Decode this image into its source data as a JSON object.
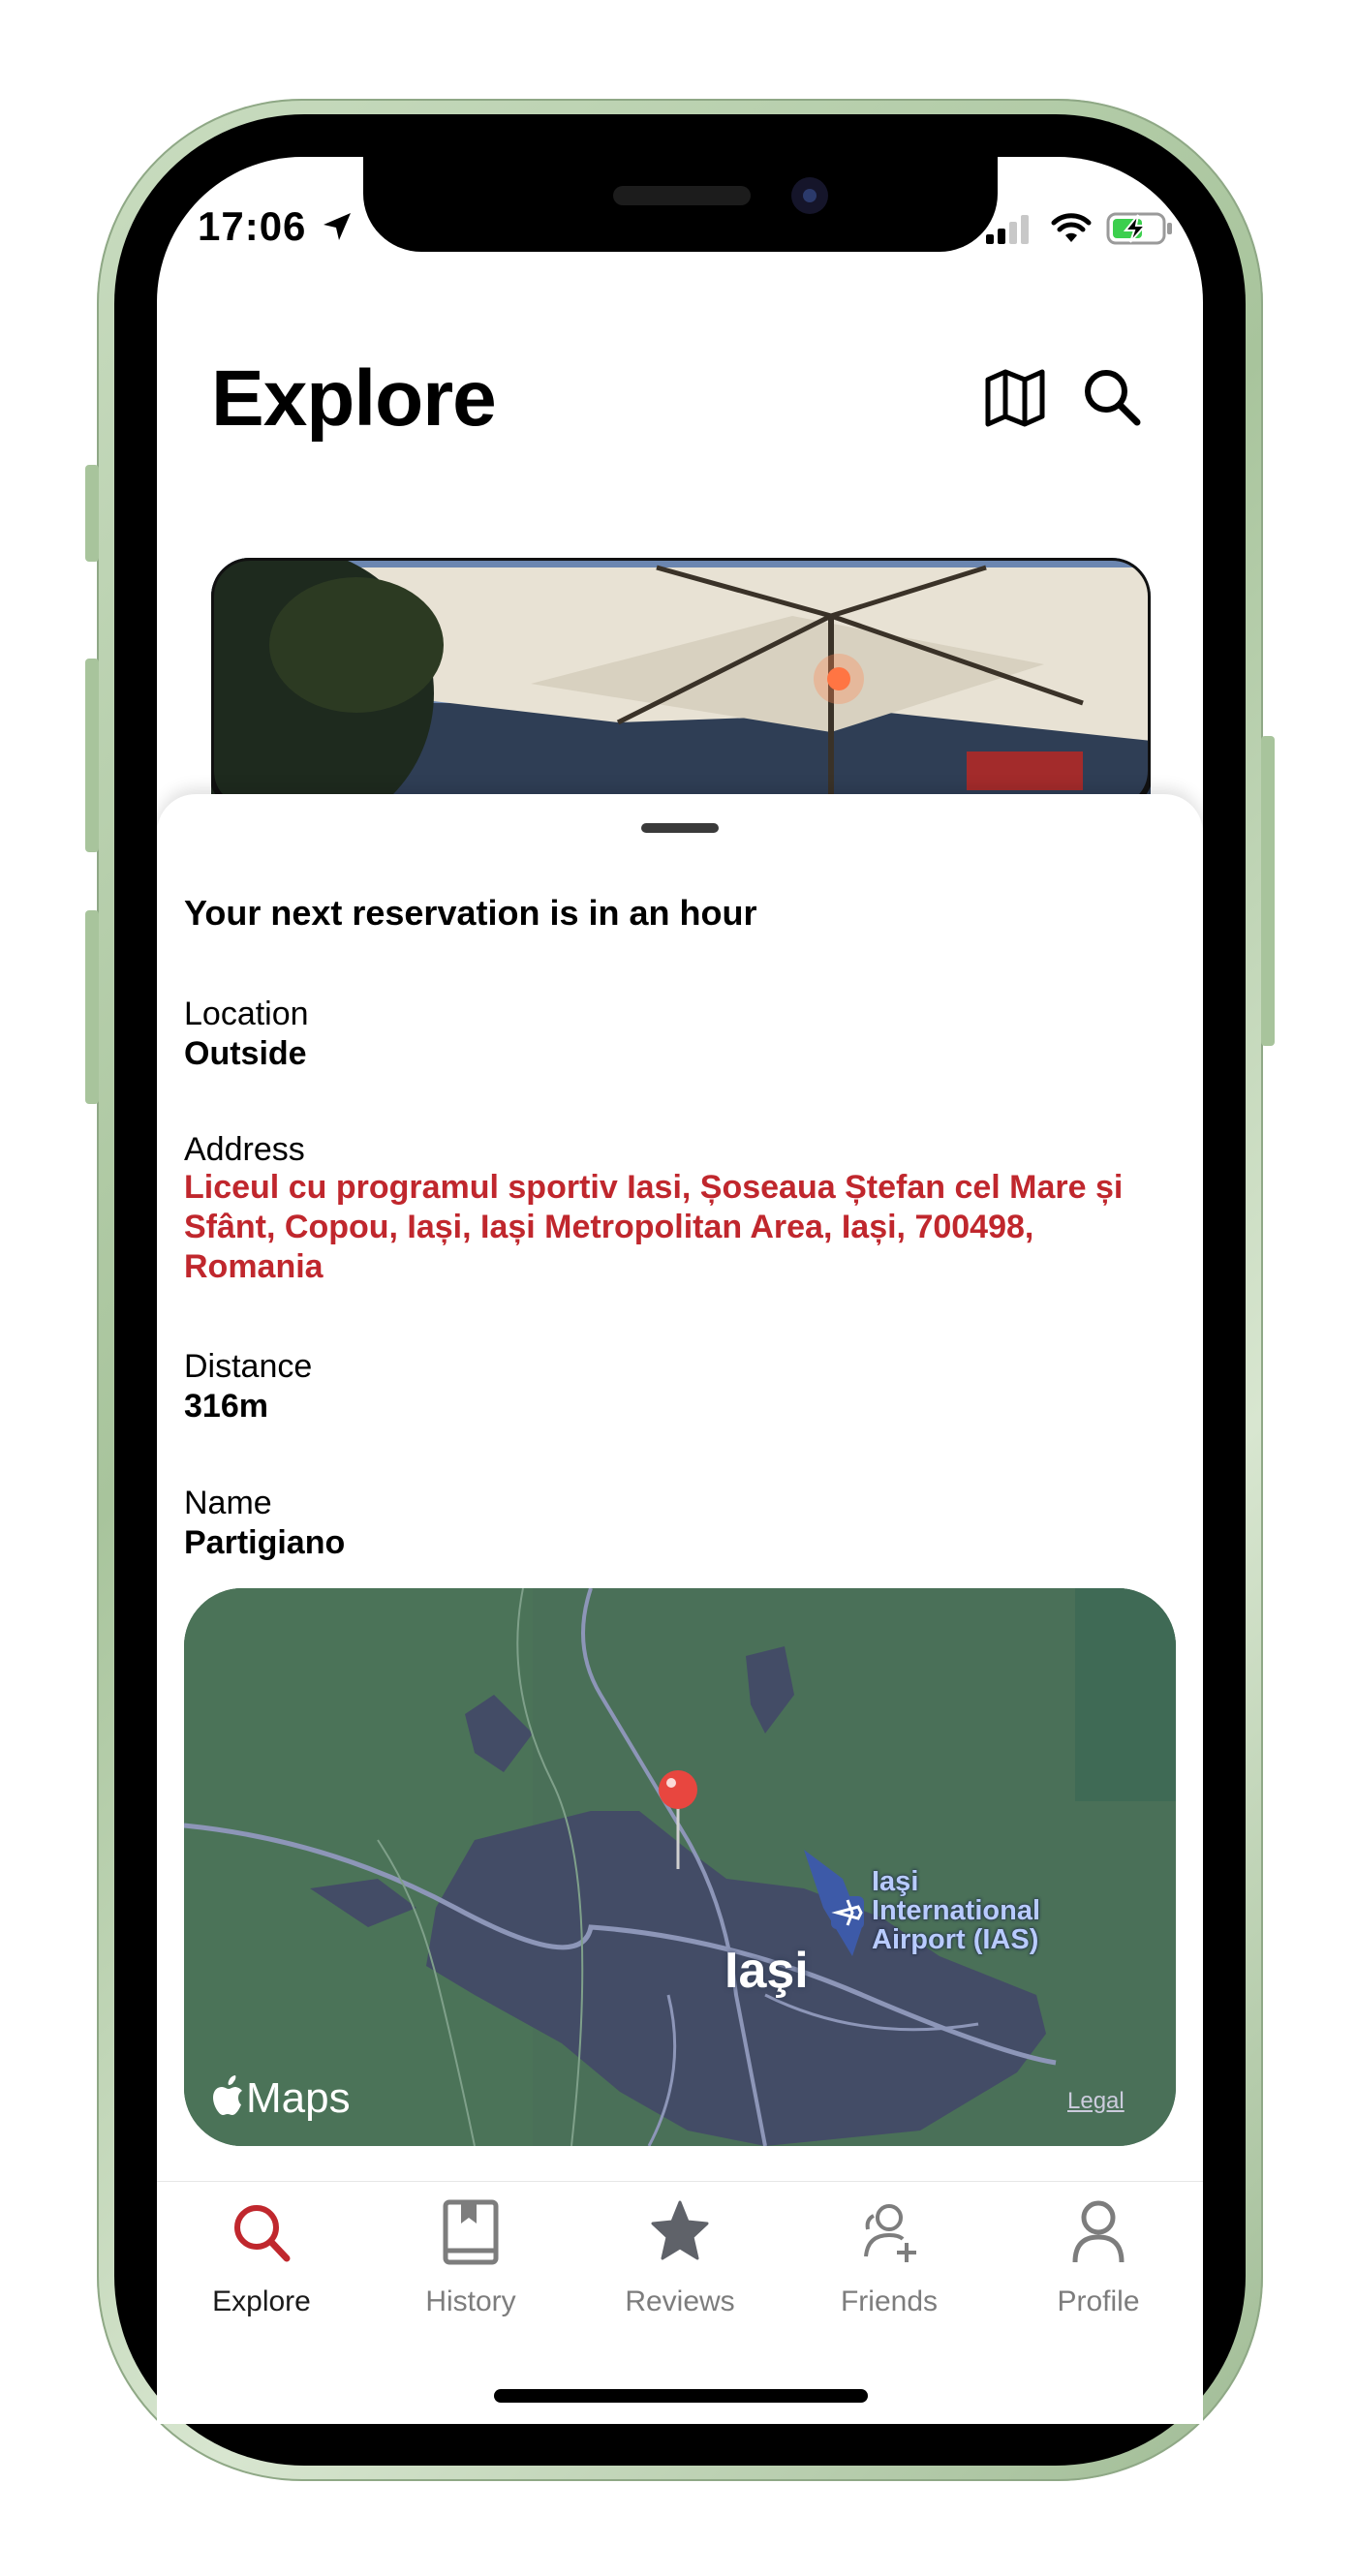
{
  "status_bar": {
    "time": "17:06"
  },
  "header": {
    "title": "Explore"
  },
  "reservation": {
    "heading": "Your next reservation is in an hour",
    "location_label": "Location",
    "location_value": "Outside",
    "address_label": "Address",
    "address_value": "Liceul cu programul sportiv Iasi, Șoseaua Ștefan cel Mare și Sfânt, Copou, Iași, Iași Metropolitan Area, Iași, 700498, Romania",
    "distance_label": "Distance",
    "distance_value": "316m",
    "name_label": "Name",
    "name_value": "Partigiano"
  },
  "map": {
    "city_label": "Iaşi",
    "airport_label_line1": "Iaşi",
    "airport_label_line2": "International",
    "airport_label_line3": "Airport (IAS)",
    "brand": "Maps",
    "legal": "Legal"
  },
  "tabs": [
    {
      "label": "Explore",
      "icon": "search-icon",
      "active": true
    },
    {
      "label": "History",
      "icon": "book-icon",
      "active": false
    },
    {
      "label": "Reviews",
      "icon": "star-icon",
      "active": false
    },
    {
      "label": "Friends",
      "icon": "add-friend-icon",
      "active": false
    },
    {
      "label": "Profile",
      "icon": "person-icon",
      "active": false
    }
  ],
  "colors": {
    "accent": "#c0272d",
    "map_land": "#4a7058",
    "map_city": "#434c66",
    "pin": "#e8463f"
  }
}
